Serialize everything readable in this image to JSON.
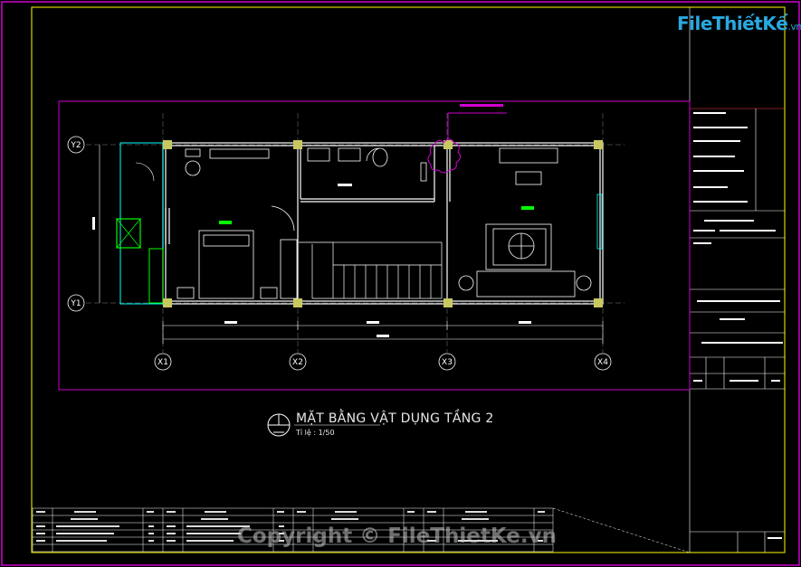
{
  "drawing": {
    "title": "MẶT BẰNG VẬT DỤNG TẦNG 2",
    "scale_label": "Tỉ lệ :",
    "scale_value": "1/50"
  },
  "grid": {
    "columns": [
      "X1",
      "X2",
      "X3",
      "X4"
    ],
    "rows": [
      "Y2",
      "Y1"
    ]
  },
  "branding": {
    "logo_main": "FileThiếtKế",
    "logo_domain": ".vn",
    "watermark": "Copyright © FileThietKe.vn"
  },
  "colors": {
    "frame": "#d000d0",
    "wall": "#ffffff",
    "column": "#c8c860",
    "accent_cyan": "#00ffff",
    "accent_green": "#00ff00",
    "logo": "#29a8e0"
  }
}
